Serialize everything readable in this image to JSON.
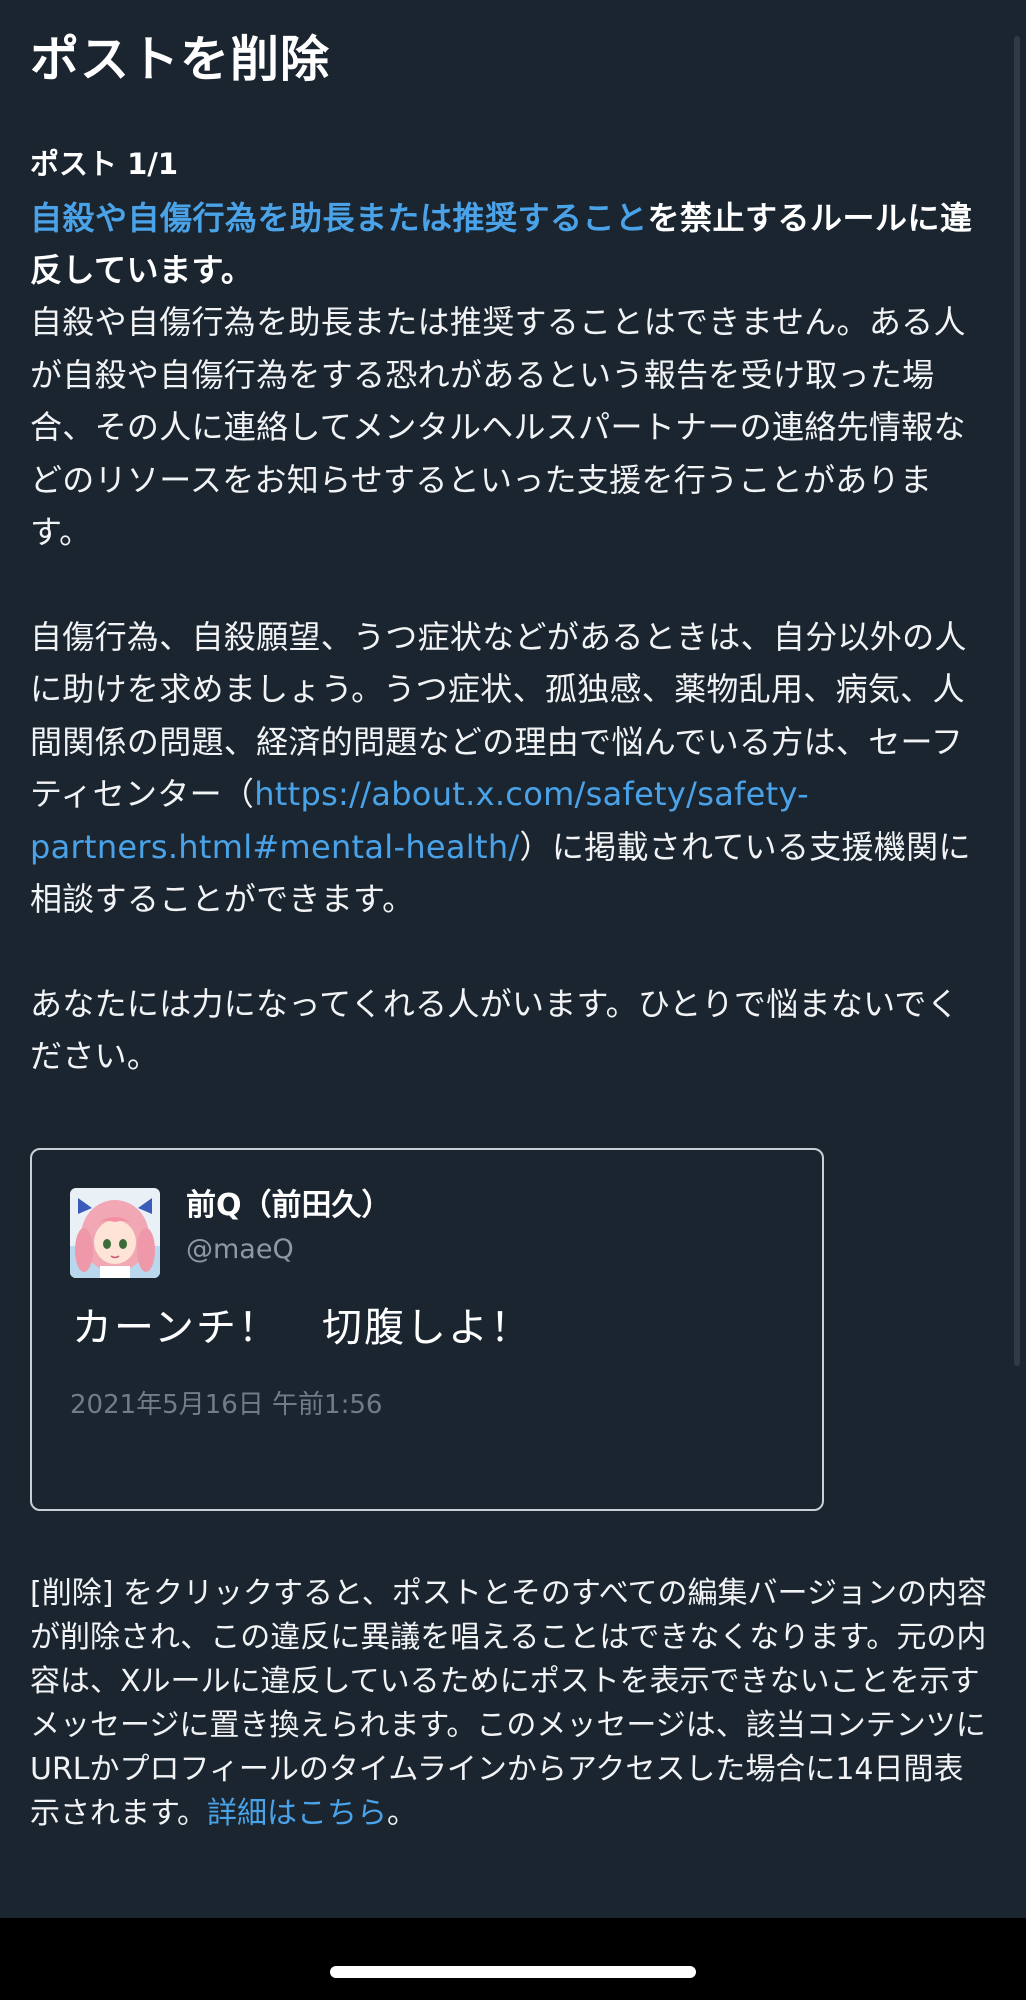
{
  "header": {
    "title": "ポストを削除"
  },
  "post_counter": "ポスト 1/1",
  "rule": {
    "link_text": "自殺や自傷行為を助長または推奨すること",
    "suffix": "を禁止するルールに違反しています。"
  },
  "paragraphs": {
    "p1": "自殺や自傷行為を助長または推奨することはできません。ある人が自殺や自傷行為をする恐れがあるという報告を受け取った場合、その人に連絡してメンタルヘルスパートナーの連絡先情報などのリソースをお知らせするといった支援を行うことがあります。",
    "p2_before": "自傷行為、自殺願望、うつ症状などがあるときは、自分以外の人に助けを求めましょう。うつ症状、孤独感、薬物乱用、病気、人間関係の問題、経済的問題などの理由で悩んでいる方は、セーフティセンター（",
    "p2_link": "https://about.x.com/safety/safety-partners.html#mental-health/",
    "p2_after": "）に掲載されている支援機関に相談することができます。",
    "p3": "あなたには力になってくれる人がいます。ひとりで悩まないでください。"
  },
  "tweet": {
    "display_name": "前Q（前田久）",
    "handle": "@maeQ",
    "text": "カーンチ！　切腹しよ！",
    "timestamp": "2021年5月16日 午前1:56",
    "avatar": "anime-girl-avatar"
  },
  "footer": {
    "text": "[削除] をクリックすると、ポストとそのすべての編集バージョンの内容が削除され、この違反に異議を唱えることはできなくなります。元の内容は、Xルールに違反しているためにポストを表示できないことを示すメッセージに置き換えられます。このメッセージは、該当コンテンツにURLかプロフィールのタイムラインからアクセスした場合に14日間表示されます。",
    "link_text": "詳細はこちら",
    "end": "。"
  },
  "colors": {
    "background": "#1b2530",
    "link": "#4aa3e8",
    "muted": "#8b98a5",
    "card_border": "#c9cfd6"
  }
}
